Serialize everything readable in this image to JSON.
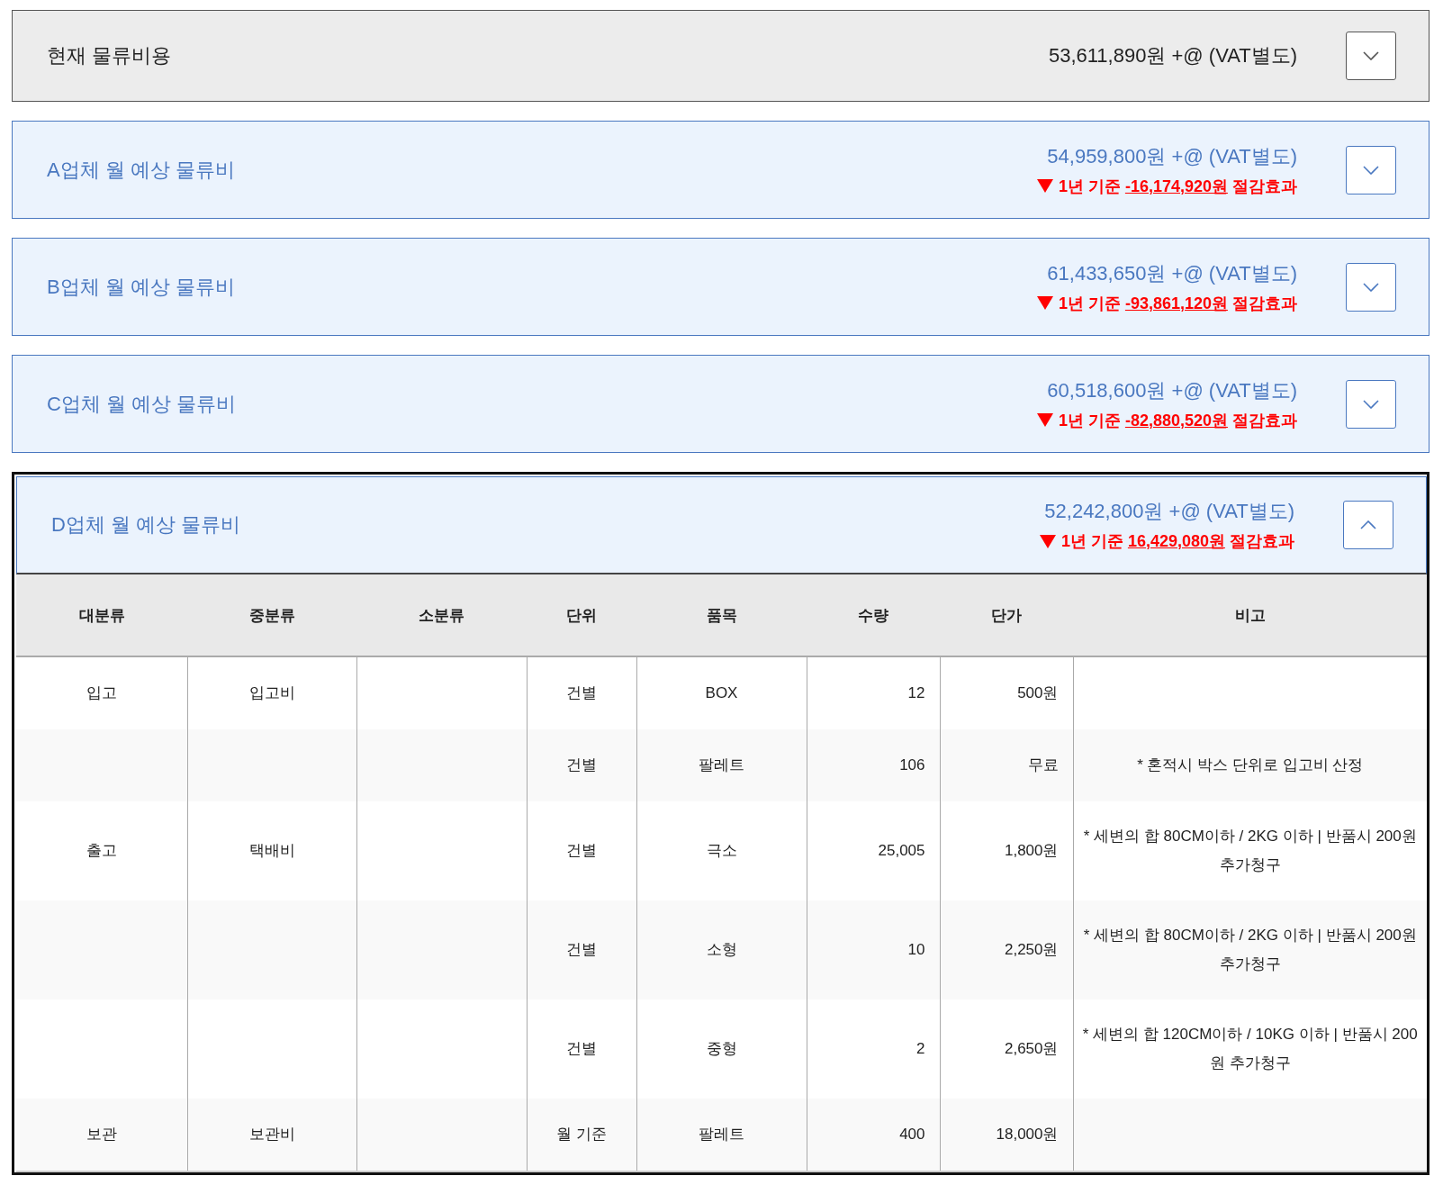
{
  "panels": [
    {
      "kind": "current",
      "title": "현재 물류비용",
      "amount": "53,611,890원 +@ (VAT별도)",
      "expanded": false
    },
    {
      "kind": "vendor",
      "title": "A업체 월 예상 물류비",
      "amount": "54,959,800원 +@ (VAT별도)",
      "savings": {
        "prefix": "1년 기준",
        "value": "-16,174,920원",
        "suffix": "절감효과"
      },
      "expanded": false
    },
    {
      "kind": "vendor",
      "title": "B업체 월 예상 물류비",
      "amount": "61,433,650원 +@ (VAT별도)",
      "savings": {
        "prefix": "1년 기준",
        "value": "-93,861,120원",
        "suffix": "절감효과"
      },
      "expanded": false
    },
    {
      "kind": "vendor",
      "title": "C업체 월 예상 물류비",
      "amount": "60,518,600원 +@ (VAT별도)",
      "savings": {
        "prefix": "1년 기준",
        "value": "-82,880,520원",
        "suffix": "절감효과"
      },
      "expanded": false
    },
    {
      "kind": "vendor",
      "title": "D업체 월 예상 물류비",
      "amount": "52,242,800원 +@ (VAT별도)",
      "savings": {
        "prefix": "1년 기준",
        "value": "16,429,080원",
        "suffix": "절감효과"
      },
      "expanded": true,
      "table": {
        "columns": [
          "대분류",
          "중분류",
          "소분류",
          "단위",
          "품목",
          "수량",
          "단가",
          "비고"
        ],
        "rows": [
          [
            "입고",
            "입고비",
            "",
            "건별",
            "BOX",
            "12",
            "500원",
            ""
          ],
          [
            "",
            "",
            "",
            "건별",
            "팔레트",
            "106",
            "무료",
            "* 혼적시 박스 단위로 입고비 산정"
          ],
          [
            "출고",
            "택배비",
            "",
            "건별",
            "극소",
            "25,005",
            "1,800원",
            "* 세변의 합 80CM이하 / 2KG 이하 | 반품시 200원 추가청구"
          ],
          [
            "",
            "",
            "",
            "건별",
            "소형",
            "10",
            "2,250원",
            "* 세변의 합 80CM이하 / 2KG 이하 | 반품시 200원 추가청구"
          ],
          [
            "",
            "",
            "",
            "건별",
            "중형",
            "2",
            "2,650원",
            "* 세변의 합 120CM이하 / 10KG 이하 | 반품시 200원 추가청구"
          ],
          [
            "보관",
            "보관비",
            "",
            "월 기준",
            "팔레트",
            "400",
            "18,000원",
            ""
          ]
        ]
      }
    }
  ]
}
